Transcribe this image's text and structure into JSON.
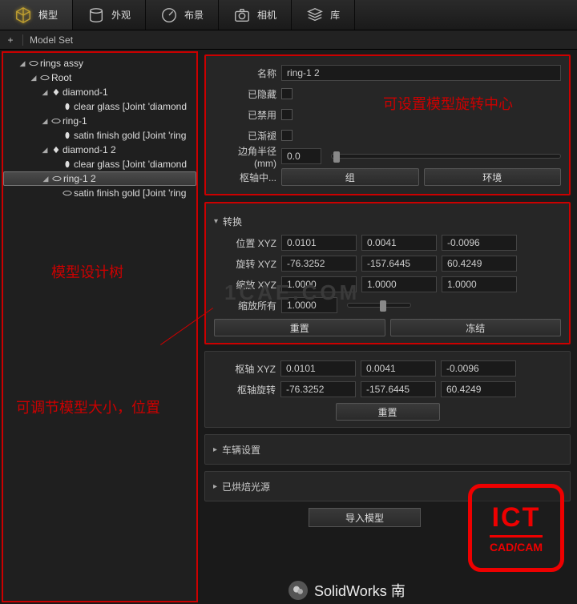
{
  "tabs": {
    "model": "模型",
    "appearance": "外观",
    "layout": "布景",
    "camera": "相机",
    "library": "库"
  },
  "subbar": {
    "modelset": "Model Set"
  },
  "tree": {
    "root_assy": "rings assy",
    "root": "Root",
    "diamond1": "diamond-1",
    "clearglass1": "clear glass [Joint 'diamond",
    "ring1": "ring-1",
    "satin1": "satin finish gold [Joint 'ring",
    "diamond12": "diamond-1 2",
    "clearglass2": "clear glass [Joint 'diamond",
    "ring12": "ring-1 2",
    "satin2": "satin finish gold [Joint 'ring"
  },
  "annot": {
    "tree_label": "模型设计树",
    "pivot_label": "可设置模型旋转中心",
    "adjust_label": "可调节模型大小，位置"
  },
  "name_panel": {
    "name_label": "名称",
    "name_value": "ring-1 2",
    "hidden_label": "已隐藏",
    "disabled_label": "已禁用",
    "faded_label": "已渐褪",
    "radius_label": "边角半径 (mm)",
    "radius_value": "0.0",
    "pivot_center_label": "枢轴中...",
    "group_btn": "组",
    "env_btn": "环境"
  },
  "transform_panel": {
    "header": "转换",
    "pos_label": "位置 XYZ",
    "pos": [
      "0.0101",
      "0.0041",
      "-0.0096"
    ],
    "rot_label": "旋转 XYZ",
    "rot": [
      "-76.3252",
      "-157.6445",
      "60.4249"
    ],
    "scale_label": "缩放 XYZ",
    "scale": [
      "1.0000",
      "1.0000",
      "1.0000"
    ],
    "scale_all_label": "缩放所有",
    "scale_all_value": "1.0000",
    "reset_btn": "重置",
    "freeze_btn": "冻结"
  },
  "pivot_panel": {
    "pivot_xyz_label": "枢轴 XYZ",
    "pivot_xyz": [
      "0.0101",
      "0.0041",
      "-0.0096"
    ],
    "pivot_rot_label": "枢轴旋转",
    "pivot_rot": [
      "-76.3252",
      "-157.6445",
      "60.4249"
    ],
    "reset_btn": "重置"
  },
  "collapsed": {
    "vehicle": "车辆设置",
    "baked": "已烘焙光源"
  },
  "import_btn": "导入模型",
  "logo": {
    "big": "ICT",
    "small": "CAD/CAM"
  },
  "footer": "SolidWorks 南",
  "watermark": "1CAE.COM"
}
